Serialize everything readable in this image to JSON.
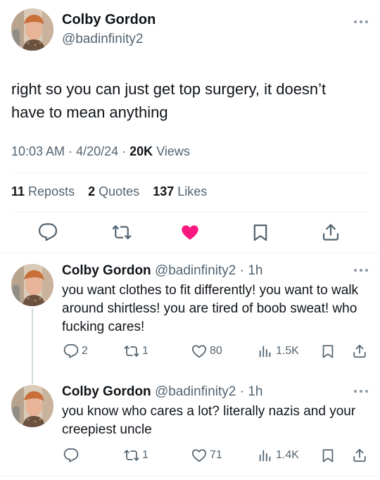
{
  "main_tweet": {
    "author_name": "Colby Gordon",
    "handle": "@badinfinity2",
    "text": "right so you can just get top surgery, it doesn’t have to mean anything",
    "time": "10:03 AM",
    "date": "4/20/24",
    "views_count": "20K",
    "views_label": "Views",
    "reposts_count": "11",
    "reposts_label": "Reposts",
    "quotes_count": "2",
    "quotes_label": "Quotes",
    "likes_count": "137",
    "likes_label": "Likes",
    "liked": true
  },
  "replies": [
    {
      "author_name": "Colby Gordon",
      "handle": "@badinfinity2",
      "time_ago": "1h",
      "text": "you want clothes to fit differently! you want to walk around shirtless! you are tired of boob sweat! who fucking cares!",
      "reply_count": "2",
      "repost_count": "1",
      "like_count": "80",
      "view_count": "1.5K"
    },
    {
      "author_name": "Colby Gordon",
      "handle": "@badinfinity2",
      "time_ago": "1h",
      "text": "you know who cares a lot? literally nazis and your creepiest uncle",
      "reply_count": "",
      "repost_count": "1",
      "like_count": "71",
      "view_count": "1.4K"
    }
  ],
  "colors": {
    "text": "#0f1419",
    "secondary": "#536471",
    "like_active": "#f91880",
    "divider": "#eff3f4"
  },
  "icons": [
    "reply-icon",
    "repost-icon",
    "like-icon",
    "bookmark-icon",
    "share-icon",
    "views-icon",
    "more-icon"
  ]
}
